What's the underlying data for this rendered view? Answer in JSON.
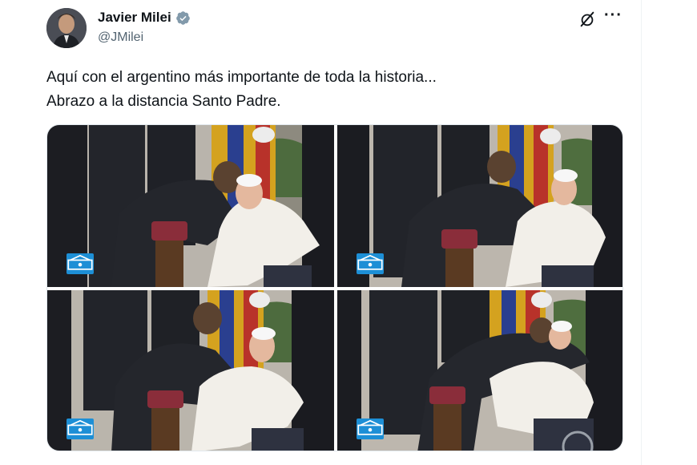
{
  "tweet": {
    "author_name": "Javier Milei",
    "author_handle": "@JMilei",
    "text_lines": [
      "Aquí con el argentino más importante de toda la historia...",
      "Abrazo a la distancia Santo Padre."
    ]
  },
  "icons": {
    "verified": "verified-badge-icon",
    "grok": "grok-slash-icon",
    "more": "more-options-icon",
    "vatican": "vatican-media-logo-icon"
  },
  "colors": {
    "verified": "#829aab",
    "text": "#0f1419",
    "secondary": "#536471",
    "vatican_badge": "#1d8fd6"
  },
  "ui": {
    "more_label": "···"
  }
}
